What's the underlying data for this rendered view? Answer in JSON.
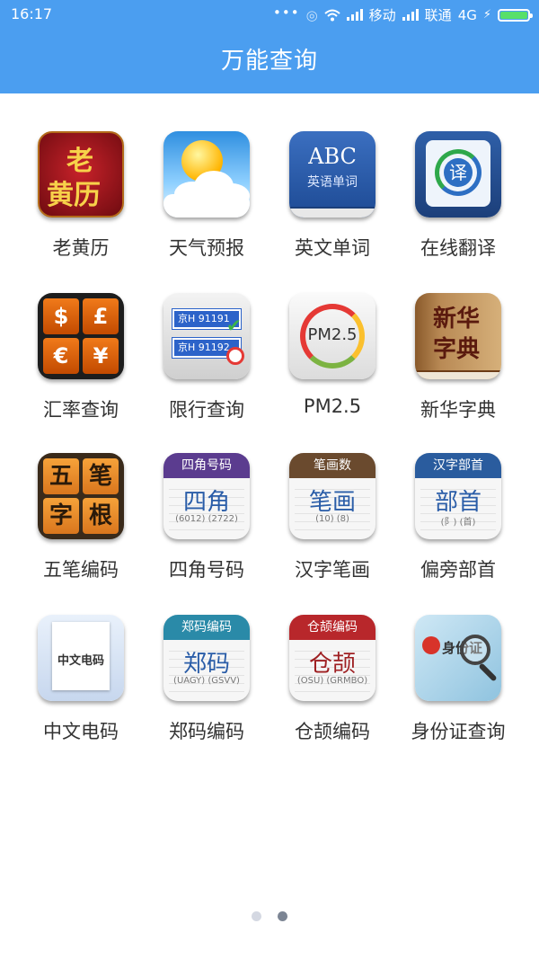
{
  "status_bar": {
    "time": "16:17",
    "carrier1": "移动",
    "carrier2": "联通",
    "network": "4G",
    "icons": [
      "more-dots-icon",
      "alarm-icon",
      "wifi-icon",
      "signal-icon",
      "signal-icon",
      "charging-icon",
      "battery-icon"
    ]
  },
  "header": {
    "title": "万能查询"
  },
  "apps": [
    {
      "label": "老黄历",
      "icon": "huangli-icon",
      "icon_text": [
        "老",
        "黄历"
      ]
    },
    {
      "label": "天气预报",
      "icon": "weather-icon"
    },
    {
      "label": "英文单词",
      "icon": "english-dictionary-icon",
      "icon_text": [
        "ABC",
        "英语单词"
      ]
    },
    {
      "label": "在线翻译",
      "icon": "translate-icon",
      "icon_text": [
        "译"
      ]
    },
    {
      "label": "汇率查询",
      "icon": "currency-icon",
      "icon_text": [
        "$",
        "£",
        "€",
        "¥"
      ]
    },
    {
      "label": "限行查询",
      "icon": "traffic-limit-icon",
      "icon_text": [
        "京H 91191",
        "京H 91192"
      ]
    },
    {
      "label": "PM2.5",
      "icon": "pm25-icon",
      "icon_text": [
        "PM2.5"
      ]
    },
    {
      "label": "新华字典",
      "icon": "xinhua-dictionary-icon",
      "icon_text": [
        "新华",
        "字典"
      ]
    },
    {
      "label": "五笔编码",
      "icon": "wubi-icon",
      "icon_text": [
        "五",
        "笔",
        "字",
        "根"
      ]
    },
    {
      "label": "四角号码",
      "icon": "sijiao-icon",
      "icon_text": [
        "四角号码",
        "四角",
        "(6012) (2722)"
      ]
    },
    {
      "label": "汉字笔画",
      "icon": "stroke-count-icon",
      "icon_text": [
        "笔画数",
        "笔画",
        "(10) (8)"
      ]
    },
    {
      "label": "偏旁部首",
      "icon": "radical-icon",
      "icon_text": [
        "汉字部首",
        "部首",
        "(阝) (首)"
      ]
    },
    {
      "label": "中文电码",
      "icon": "telegraph-code-icon",
      "icon_text": [
        "中文电码"
      ]
    },
    {
      "label": "郑码编码",
      "icon": "zhengma-icon",
      "icon_text": [
        "郑码编码",
        "郑码",
        "(UAGY) (GSVV)"
      ]
    },
    {
      "label": "仓颉编码",
      "icon": "cangjie-icon",
      "icon_text": [
        "仓颉编码",
        "仓颉",
        "(OSU) (GRMBO)"
      ]
    },
    {
      "label": "身份证查询",
      "icon": "id-card-search-icon",
      "icon_text": [
        "身份证"
      ]
    }
  ],
  "pager": {
    "count": 2,
    "active_index": 1
  },
  "colors": {
    "header_bg": "#4b9ef0",
    "label": "#333333",
    "band_purple": "#5b3c8f",
    "band_brown": "#6a4a2e",
    "band_blue": "#2a5c9e",
    "band_teal": "#2a8aa8",
    "band_red": "#b8272b"
  }
}
